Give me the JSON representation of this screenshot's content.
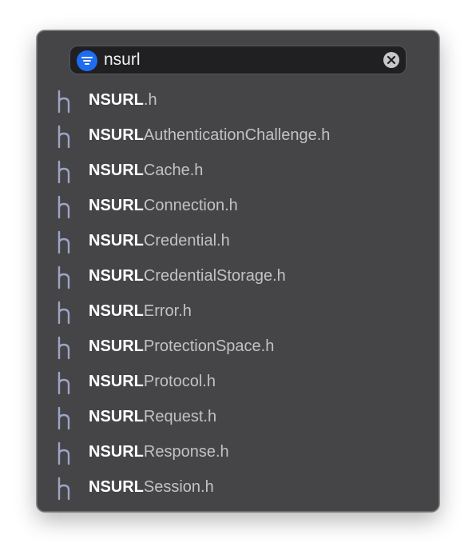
{
  "search": {
    "query": "nsurl",
    "filter_icon": "filter-lines-icon",
    "clear_icon": "clear-circle-x-icon",
    "accent_color": "#1f6cf0"
  },
  "results": [
    {
      "match": "NSURL",
      "rest": ".h",
      "icon": "header-file-h-icon"
    },
    {
      "match": "NSURL",
      "rest": "AuthenticationChallenge.h",
      "icon": "header-file-h-icon"
    },
    {
      "match": "NSURL",
      "rest": "Cache.h",
      "icon": "header-file-h-icon"
    },
    {
      "match": "NSURL",
      "rest": "Connection.h",
      "icon": "header-file-h-icon"
    },
    {
      "match": "NSURL",
      "rest": "Credential.h",
      "icon": "header-file-h-icon"
    },
    {
      "match": "NSURL",
      "rest": "CredentialStorage.h",
      "icon": "header-file-h-icon"
    },
    {
      "match": "NSURL",
      "rest": "Error.h",
      "icon": "header-file-h-icon"
    },
    {
      "match": "NSURL",
      "rest": "ProtectionSpace.h",
      "icon": "header-file-h-icon"
    },
    {
      "match": "NSURL",
      "rest": "Protocol.h",
      "icon": "header-file-h-icon"
    },
    {
      "match": "NSURL",
      "rest": "Request.h",
      "icon": "header-file-h-icon"
    },
    {
      "match": "NSURL",
      "rest": "Response.h",
      "icon": "header-file-h-icon"
    },
    {
      "match": "NSURL",
      "rest": "Session.h",
      "icon": "header-file-h-icon"
    }
  ]
}
